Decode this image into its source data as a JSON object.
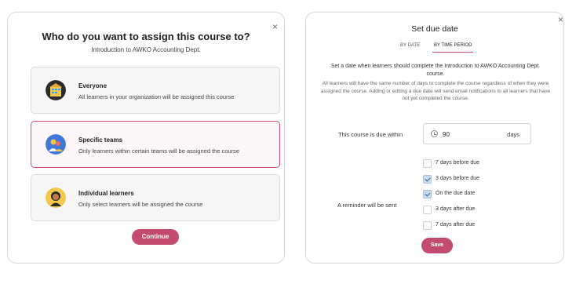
{
  "left": {
    "title": "Who do you want to assign this course to?",
    "subtitle": "Introduction to AWKO Accounting Dept.",
    "close": "×",
    "options": [
      {
        "title": "Everyone",
        "desc": "All learners in your organization will be assigned this course",
        "icon": "building-icon",
        "selected": false
      },
      {
        "title": "Specific teams",
        "desc": "Only learners within certain teams will be assigned the course",
        "icon": "team-icon",
        "selected": true
      },
      {
        "title": "Individual learners",
        "desc": "Only select learners will be assigned the course",
        "icon": "person-icon",
        "selected": false
      }
    ],
    "continue_label": "Continue"
  },
  "right": {
    "close": "×",
    "title": "Set due date",
    "tabs": {
      "by_date": "BY DATE",
      "by_time_period": "BY TIME PERIOD",
      "active": "by_time_period"
    },
    "desc1": "Set a date when learners should complete the Introduction to AWKO Accounting Dept. course.",
    "desc2": "All learners will have the same number of days to complete the course regardless of when they were assigned the course. Adding or editing a due date will send email notifications to all learners that have not yet completed the course.",
    "due_label": "This course is due within",
    "due_value": "90",
    "due_unit": "days",
    "reminder_label": "A reminder will be sent",
    "reminders": [
      {
        "label": "7 days before due",
        "checked": false
      },
      {
        "label": "3 days before due",
        "checked": true
      },
      {
        "label": "On the due date",
        "checked": true
      },
      {
        "label": "3 days after due",
        "checked": false
      },
      {
        "label": "7 days after due",
        "checked": false
      }
    ],
    "save_label": "Save"
  },
  "colors": {
    "accent": "#c34b6f",
    "selected_border": "#d1536f",
    "checkbox_checked": "#c9dcef"
  }
}
